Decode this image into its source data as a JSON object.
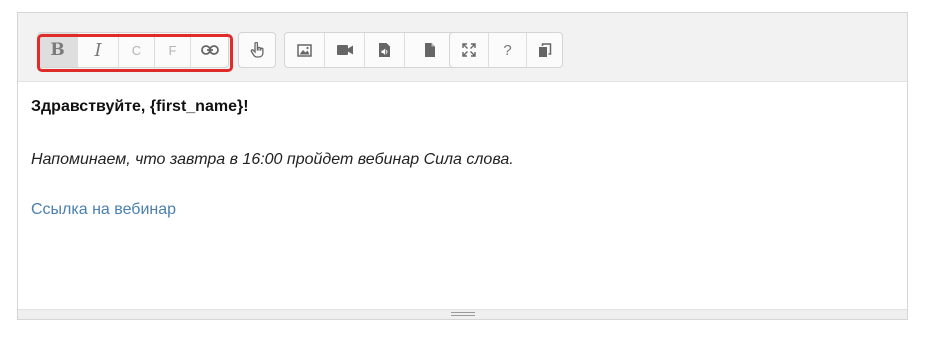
{
  "toolbar": {
    "format_group": {
      "bold": "B",
      "italic": "I",
      "c": "C",
      "f": "F",
      "link_icon": "link-icon"
    },
    "interaction_group": {
      "icon": "pointing-hand-icon"
    },
    "media_group": [
      "image-icon",
      "video-icon",
      "audio-file-icon",
      "file-icon"
    ],
    "tools_group": {
      "fullscreen_icon": "fullscreen-icon",
      "help": "?",
      "copy_icon": "copy-icon"
    },
    "highlight_color": "#e02b2b"
  },
  "content": {
    "greeting": "Здравствуйте, {first_name}!",
    "reminder": "Напоминаем, что завтра в 16:00 пройдет вебинар Сила слова.",
    "link_text": "Ссылка на вебинар",
    "link_color": "#4a7fb0"
  }
}
